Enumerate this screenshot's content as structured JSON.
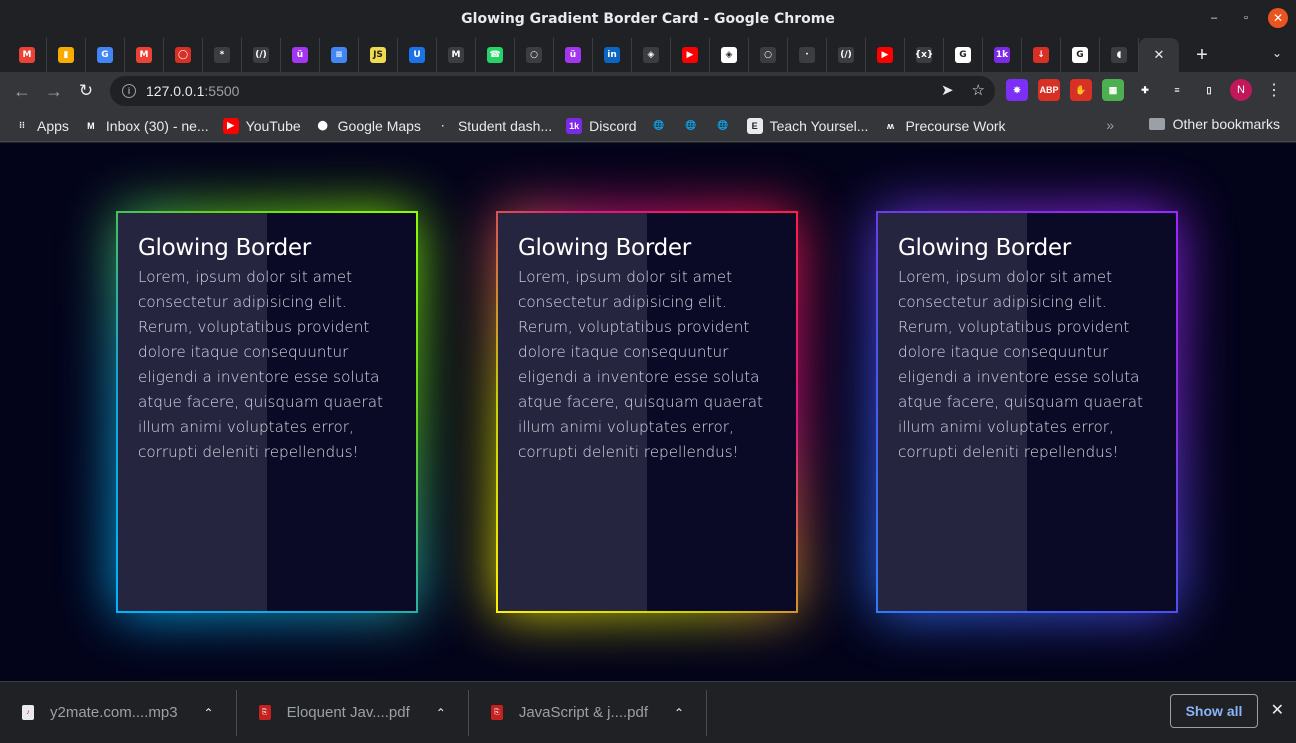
{
  "window": {
    "title": "Glowing Gradient Border Card - Google Chrome"
  },
  "tabs": [
    {
      "icon": "gmail-icon",
      "color": "#ea4335",
      "glyph": "M"
    },
    {
      "icon": "analytics-icon",
      "color": "#f9ab00",
      "glyph": "▮"
    },
    {
      "icon": "google-icon",
      "color": "#4285f4",
      "glyph": "G"
    },
    {
      "icon": "gmail-icon",
      "color": "#ea4335",
      "glyph": "M"
    },
    {
      "icon": "circle-icon",
      "color": "#d93025",
      "glyph": "◯"
    },
    {
      "icon": "palm-icon",
      "color": "#3c3d40",
      "glyph": "*"
    },
    {
      "icon": "codecamp-icon",
      "color": "#3c3d40",
      "glyph": "(/)"
    },
    {
      "icon": "udemy-icon",
      "color": "#a435f0",
      "glyph": "ü"
    },
    {
      "icon": "docs-icon",
      "color": "#4285f4",
      "glyph": "≡"
    },
    {
      "icon": "js-icon",
      "color": "#f0db4f",
      "glyph": "JS"
    },
    {
      "icon": "u-icon",
      "color": "#1a73e8",
      "glyph": "U"
    },
    {
      "icon": "m-icon",
      "color": "#3c3d40",
      "glyph": "M"
    },
    {
      "icon": "whatsapp-icon",
      "color": "#25d366",
      "glyph": "☎"
    },
    {
      "icon": "github-icon",
      "color": "#3c3d40",
      "glyph": "○"
    },
    {
      "icon": "udemy-icon",
      "color": "#a435f0",
      "glyph": "ü"
    },
    {
      "icon": "linkedin-icon",
      "color": "#0a66c2",
      "glyph": "in"
    },
    {
      "icon": "codepen-icon",
      "color": "#3c3d40",
      "glyph": "◈"
    },
    {
      "icon": "youtube-icon",
      "color": "#ff0000",
      "glyph": "▶"
    },
    {
      "icon": "codepen-icon",
      "color": "#ffffff",
      "glyph": "◈"
    },
    {
      "icon": "github-icon",
      "color": "#3c3d40",
      "glyph": "○"
    },
    {
      "icon": "gfx-icon",
      "color": "#3c3d40",
      "glyph": "·"
    },
    {
      "icon": "codecamp-icon",
      "color": "#3c3d40",
      "glyph": "(/)"
    },
    {
      "icon": "youtube-icon",
      "color": "#ff0000",
      "glyph": "▶"
    },
    {
      "icon": "variable-icon",
      "color": "#3c3d40",
      "glyph": "{x}"
    },
    {
      "icon": "google-icon",
      "color": "#ffffff",
      "glyph": "G"
    },
    {
      "icon": "discord-icon",
      "color": "#7d2ae8",
      "glyph": "1k"
    },
    {
      "icon": "download-icon",
      "color": "#d93025",
      "glyph": "↓"
    },
    {
      "icon": "google-icon",
      "color": "#ffffff",
      "glyph": "G"
    },
    {
      "icon": "audio-icon",
      "color": "#3c3d40",
      "glyph": "◖"
    }
  ],
  "address": {
    "host": "127.0.0.1",
    "port": ":5500"
  },
  "extensions": [
    {
      "icon": "extension-purple-icon",
      "color": "#7b2ff7",
      "glyph": "✸"
    },
    {
      "icon": "adblock-icon",
      "color": "#d93025",
      "glyph": "ABP"
    },
    {
      "icon": "hand-icon",
      "color": "#d93025",
      "glyph": "✋"
    },
    {
      "icon": "colorzilla-icon",
      "color": "#4caf50",
      "glyph": "▦"
    },
    {
      "icon": "puzzle-icon",
      "color": "#35363a",
      "glyph": "✚"
    },
    {
      "icon": "media-icon",
      "color": "#35363a",
      "glyph": "≡"
    },
    {
      "icon": "sidepanel-icon",
      "color": "#35363a",
      "glyph": "▯"
    }
  ],
  "profile_initial": "N",
  "bookmarks": [
    {
      "label": "Apps",
      "icon": "apps-grid-icon",
      "color": "#35363a",
      "glyph": "⁝⁝"
    },
    {
      "label": "Inbox (30) - ne...",
      "icon": "gmail-icon",
      "color": "#35363a",
      "glyph": "M"
    },
    {
      "label": "YouTube",
      "icon": "youtube-icon",
      "color": "#ff0000",
      "glyph": "▶"
    },
    {
      "label": "Google Maps",
      "icon": "maps-pin-icon",
      "color": "#35363a",
      "glyph": "⬤"
    },
    {
      "label": "Student dash...",
      "icon": "gfx-icon",
      "color": "#35363a",
      "glyph": "·"
    },
    {
      "label": "Discord",
      "icon": "discord-icon",
      "color": "#7d2ae8",
      "glyph": "1k"
    },
    {
      "label": "",
      "icon": "globe-icon",
      "color": "#35363a",
      "glyph": "🌐"
    },
    {
      "label": "",
      "icon": "globe-icon",
      "color": "#35363a",
      "glyph": "🌐"
    },
    {
      "label": "",
      "icon": "globe-icon",
      "color": "#35363a",
      "glyph": "🌐"
    },
    {
      "label": "Teach Yoursel...",
      "icon": "e-letter-icon",
      "color": "#e8eaed",
      "glyph": "E"
    },
    {
      "label": "Precourse Work",
      "icon": "precourse-icon",
      "color": "#35363a",
      "glyph": "ʍ"
    }
  ],
  "bookmarks_overflow": "»",
  "other_bookmarks": "Other bookmarks",
  "cards": [
    {
      "title": "Glowing Border",
      "body": "Lorem, ipsum dolor sit amet consectetur adipisicing elit. Rerum, voluptatibus provident dolore itaque consequuntur eligendi a inventore esse soluta atque facere, quisquam quaerat illum animi voluptates error, corrupti deleniti repellendus!",
      "gradient": [
        "#00b4ff",
        "#8cff00"
      ]
    },
    {
      "title": "Glowing Border",
      "body": "Lorem, ipsum dolor sit amet consectetur adipisicing elit. Rerum, voluptatibus provident dolore itaque consequuntur eligendi a inventore esse soluta atque facere, quisquam quaerat illum animi voluptates error, corrupti deleniti repellendus!",
      "gradient": [
        "#fff200",
        "#ff1d4a"
      ]
    },
    {
      "title": "Glowing Border",
      "body": "Lorem, ipsum dolor sit amet consectetur adipisicing elit. Rerum, voluptatibus provident dolore itaque consequuntur eligendi a inventore esse soluta atque facere, quisquam quaerat illum animi voluptates error, corrupti deleniti repellendus!",
      "gradient": [
        "#2f7bff",
        "#9c27ff"
      ]
    }
  ],
  "downloads": [
    {
      "name": "y2mate.com....mp3",
      "icon": "audio-file-icon"
    },
    {
      "name": "Eloquent Jav....pdf",
      "icon": "pdf-icon"
    },
    {
      "name": "JavaScript & j....pdf",
      "icon": "pdf-icon"
    }
  ],
  "show_all": "Show all",
  "colors": {
    "page_bg": "#03031a",
    "chrome_dark": "#202124",
    "chrome_toolbar": "#35363a",
    "link_blue": "#8ab4f8"
  }
}
